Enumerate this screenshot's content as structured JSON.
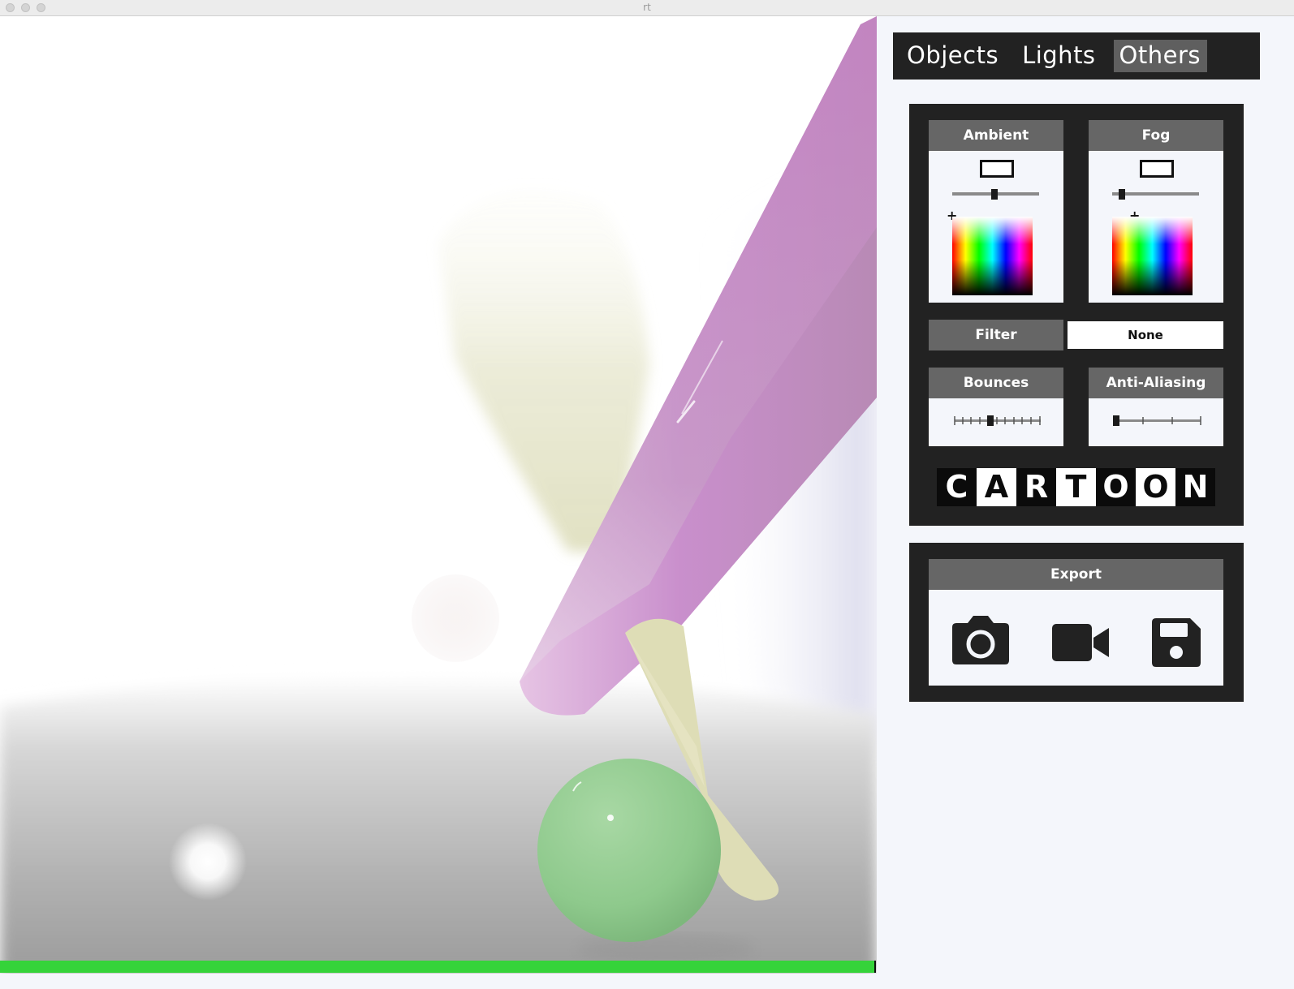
{
  "window": {
    "title": "rt"
  },
  "tabs": [
    {
      "label": "Objects",
      "active": false
    },
    {
      "label": "Lights",
      "active": false
    },
    {
      "label": "Others",
      "active": true
    }
  ],
  "ambient": {
    "title": "Ambient",
    "slider_value": 0.48,
    "color_cursor": "+"
  },
  "fog": {
    "title": "Fog",
    "slider_value": 0.08,
    "color_cursor": "+"
  },
  "filter": {
    "label": "Filter",
    "value": "None"
  },
  "bounces": {
    "title": "Bounces"
  },
  "anti_aliasing": {
    "title": "Anti-Aliasing"
  },
  "cartoon": {
    "letters": [
      "C",
      "A",
      "R",
      "T",
      "O",
      "O",
      "N"
    ]
  },
  "export": {
    "title": "Export",
    "icons": [
      "camera-icon",
      "video-camera-icon",
      "floppy-disk-icon"
    ]
  },
  "render": {
    "progress": 0.997,
    "progress_color": "#35d33a"
  }
}
